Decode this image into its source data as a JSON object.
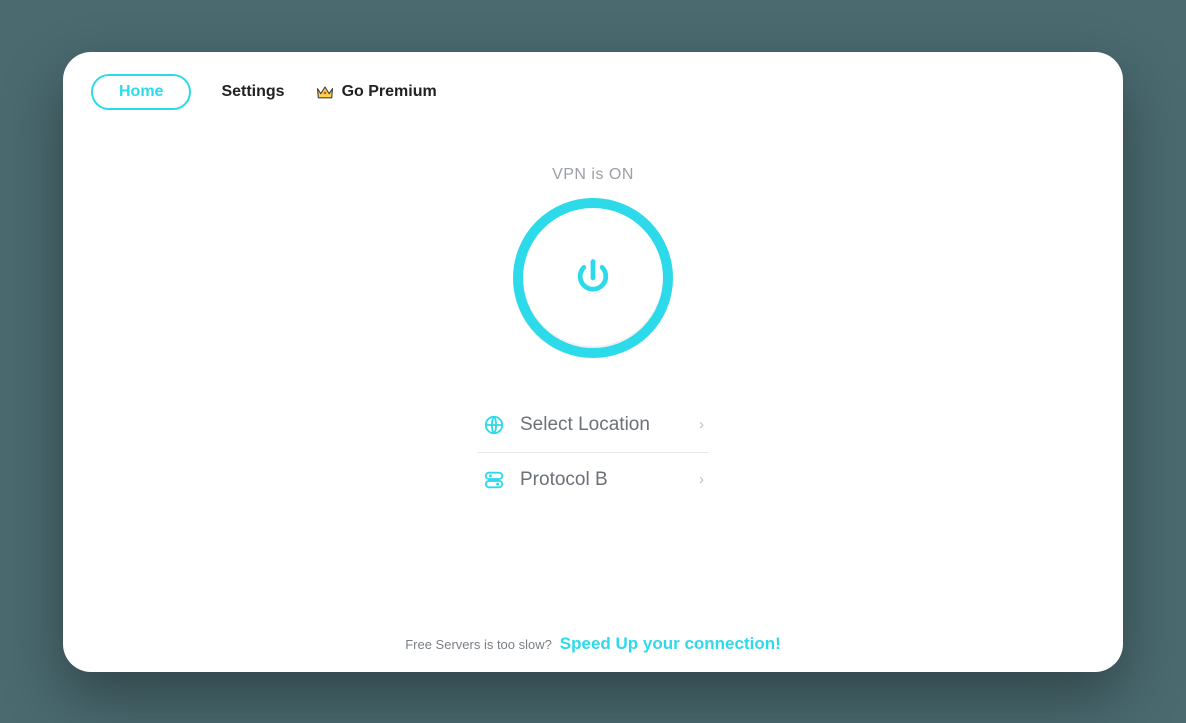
{
  "nav": {
    "home": "Home",
    "settings": "Settings",
    "premium": "Go Premium"
  },
  "status": "VPN is ON",
  "options": {
    "location": "Select Location",
    "protocol": "Protocol B"
  },
  "footer": {
    "prefix": "Free Servers is too slow?",
    "link": "Speed Up your connection!"
  },
  "colors": {
    "accent": "#2ddaea"
  }
}
